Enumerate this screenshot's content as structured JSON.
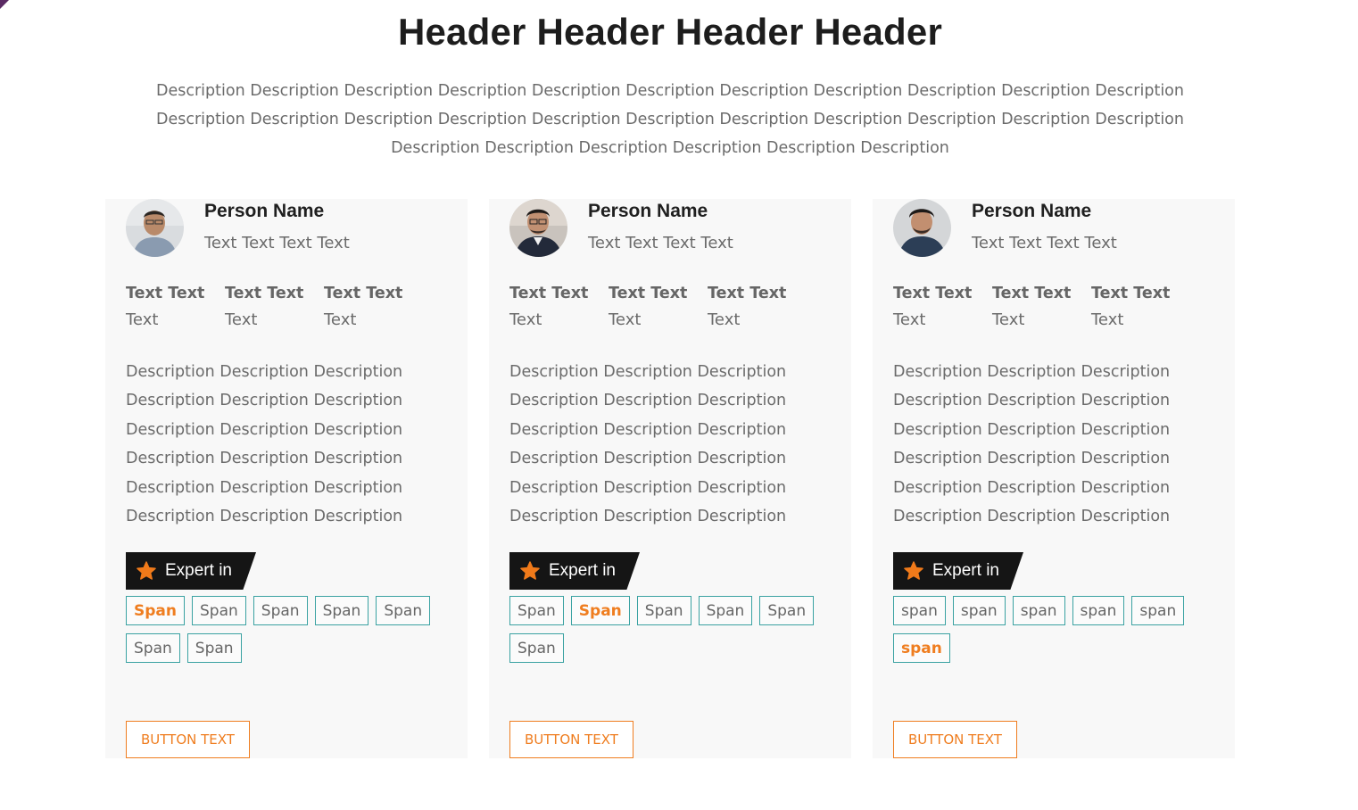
{
  "header": {
    "title": "Header Header Header Header"
  },
  "description": [
    "Description Description Description Description Description Description Description Description Description Description Description",
    "Description Description Description Description Description Description Description Description Description Description Description",
    "Description Description Description Description Description Description"
  ],
  "colors": {
    "accent": "#ef7d1f",
    "tag_border": "#3aa2a2",
    "card_bg": "#f8f8f8",
    "expert_bg": "#151515"
  },
  "cards": [
    {
      "name": "Person Name",
      "role": "Text Text Text Text",
      "stats": [
        {
          "label": "Text Text",
          "value": "Text"
        },
        {
          "label": "Text Text",
          "value": "Text"
        },
        {
          "label": "Text Text",
          "value": "Text"
        }
      ],
      "description": [
        "Description Description Description",
        "Description Description Description",
        "Description Description Description",
        "Description Description Description",
        "Description Description Description",
        "Description Description Description"
      ],
      "expert_label": "Expert in",
      "tags": [
        "Span",
        "Span",
        "Span",
        "Span",
        "Span",
        "Span",
        "Span"
      ],
      "highlighted_tag": 0,
      "button_label": "BUTTON TEXT"
    },
    {
      "name": "Person Name",
      "role": "Text Text Text Text",
      "stats": [
        {
          "label": "Text Text",
          "value": "Text"
        },
        {
          "label": "Text Text",
          "value": "Text"
        },
        {
          "label": "Text Text",
          "value": "Text"
        }
      ],
      "description": [
        "Description Description Description",
        "Description Description Description",
        "Description Description Description",
        "Description Description Description",
        "Description Description Description",
        "Description Description Description"
      ],
      "expert_label": "Expert in",
      "tags": [
        "Span",
        "Span",
        "Span",
        "Span",
        "Span",
        "Span"
      ],
      "highlighted_tag": 1,
      "button_label": "BUTTON TEXT"
    },
    {
      "name": "Person Name",
      "role": "Text Text Text Text",
      "stats": [
        {
          "label": "Text Text",
          "value": "Text"
        },
        {
          "label": "Text Text",
          "value": "Text"
        },
        {
          "label": "Text Text",
          "value": "Text"
        }
      ],
      "description": [
        "Description Description Description",
        "Description Description Description",
        "Description Description Description",
        "Description Description Description",
        "Description Description Description",
        "Description Description Description"
      ],
      "expert_label": "Expert in",
      "tags": [
        "span",
        "span",
        "span",
        "span",
        "span",
        "span"
      ],
      "highlighted_tag": 5,
      "button_label": "BUTTON TEXT"
    }
  ]
}
